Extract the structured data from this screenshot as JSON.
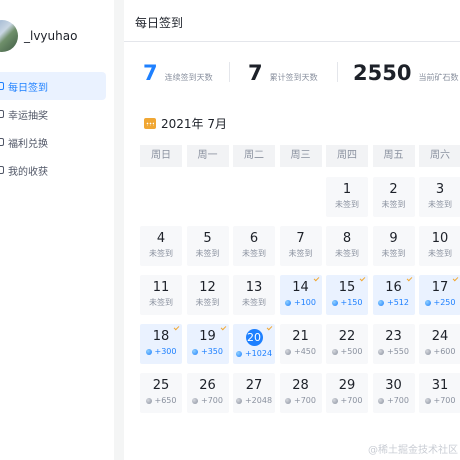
{
  "sidebar": {
    "username": "_lvyuhao",
    "items": [
      {
        "label": "每日签到",
        "active": true
      },
      {
        "label": "幸运抽奖",
        "active": false
      },
      {
        "label": "福利兑换",
        "active": false
      },
      {
        "label": "我的收获",
        "active": false
      }
    ]
  },
  "main": {
    "title": "每日签到",
    "stats": {
      "consecutive": {
        "value": "7",
        "label": "连续签到天数"
      },
      "total": {
        "value": "7",
        "label": "累计签到天数"
      },
      "ore": {
        "value": "2550",
        "label": "当前矿石数"
      }
    },
    "month": "2021年 7月",
    "weekdays": [
      "周日",
      "周一",
      "周二",
      "周三",
      "周四",
      "周五",
      "周六"
    ],
    "days": [
      {
        "n": "1",
        "s": "未签到",
        "col": 4,
        "row": 0
      },
      {
        "n": "2",
        "s": "未签到",
        "col": 5,
        "row": 0
      },
      {
        "n": "3",
        "s": "未签到",
        "col": 6,
        "row": 0
      },
      {
        "n": "4",
        "s": "未签到",
        "col": 0,
        "row": 1
      },
      {
        "n": "5",
        "s": "未签到",
        "col": 1,
        "row": 1
      },
      {
        "n": "6",
        "s": "未签到",
        "col": 2,
        "row": 1
      },
      {
        "n": "7",
        "s": "未签到",
        "col": 3,
        "row": 1
      },
      {
        "n": "8",
        "s": "未签到",
        "col": 4,
        "row": 1
      },
      {
        "n": "9",
        "s": "未签到",
        "col": 5,
        "row": 1
      },
      {
        "n": "10",
        "s": "未签到",
        "col": 6,
        "row": 1
      },
      {
        "n": "11",
        "s": "未签到",
        "col": 0,
        "row": 2
      },
      {
        "n": "12",
        "s": "未签到",
        "col": 1,
        "row": 2
      },
      {
        "n": "13",
        "s": "未签到",
        "col": 2,
        "row": 2
      },
      {
        "n": "14",
        "s": "+100",
        "ore": "blue",
        "signed": true,
        "col": 3,
        "row": 2
      },
      {
        "n": "15",
        "s": "+150",
        "ore": "blue",
        "signed": true,
        "col": 4,
        "row": 2
      },
      {
        "n": "16",
        "s": "+512",
        "ore": "blue",
        "signed": true,
        "col": 5,
        "row": 2
      },
      {
        "n": "17",
        "s": "+250",
        "ore": "blue",
        "signed": true,
        "col": 6,
        "row": 2
      },
      {
        "n": "18",
        "s": "+300",
        "ore": "blue",
        "signed": true,
        "col": 0,
        "row": 3
      },
      {
        "n": "19",
        "s": "+350",
        "ore": "blue",
        "signed": true,
        "col": 1,
        "row": 3
      },
      {
        "n": "20",
        "s": "+1024",
        "ore": "blue",
        "signed": true,
        "today": true,
        "col": 2,
        "row": 3
      },
      {
        "n": "21",
        "s": "+450",
        "ore": "gray",
        "col": 3,
        "row": 3
      },
      {
        "n": "22",
        "s": "+500",
        "ore": "gray",
        "col": 4,
        "row": 3
      },
      {
        "n": "23",
        "s": "+550",
        "ore": "gray",
        "col": 5,
        "row": 3
      },
      {
        "n": "24",
        "s": "+600",
        "ore": "gray",
        "col": 6,
        "row": 3
      },
      {
        "n": "25",
        "s": "+650",
        "ore": "gray",
        "col": 0,
        "row": 4
      },
      {
        "n": "26",
        "s": "+700",
        "ore": "gray",
        "col": 1,
        "row": 4
      },
      {
        "n": "27",
        "s": "+2048",
        "ore": "gray",
        "col": 2,
        "row": 4
      },
      {
        "n": "28",
        "s": "+700",
        "ore": "gray",
        "col": 3,
        "row": 4
      },
      {
        "n": "29",
        "s": "+700",
        "ore": "gray",
        "col": 4,
        "row": 4
      },
      {
        "n": "30",
        "s": "+700",
        "ore": "gray",
        "col": 5,
        "row": 4
      },
      {
        "n": "31",
        "s": "+700",
        "ore": "gray",
        "col": 6,
        "row": 4
      }
    ]
  },
  "watermark": "@稀土掘金技术社区",
  "colors": {
    "accent": "#1e80ff",
    "signed_bg": "#eaf2ff",
    "check": "#f0a734"
  }
}
